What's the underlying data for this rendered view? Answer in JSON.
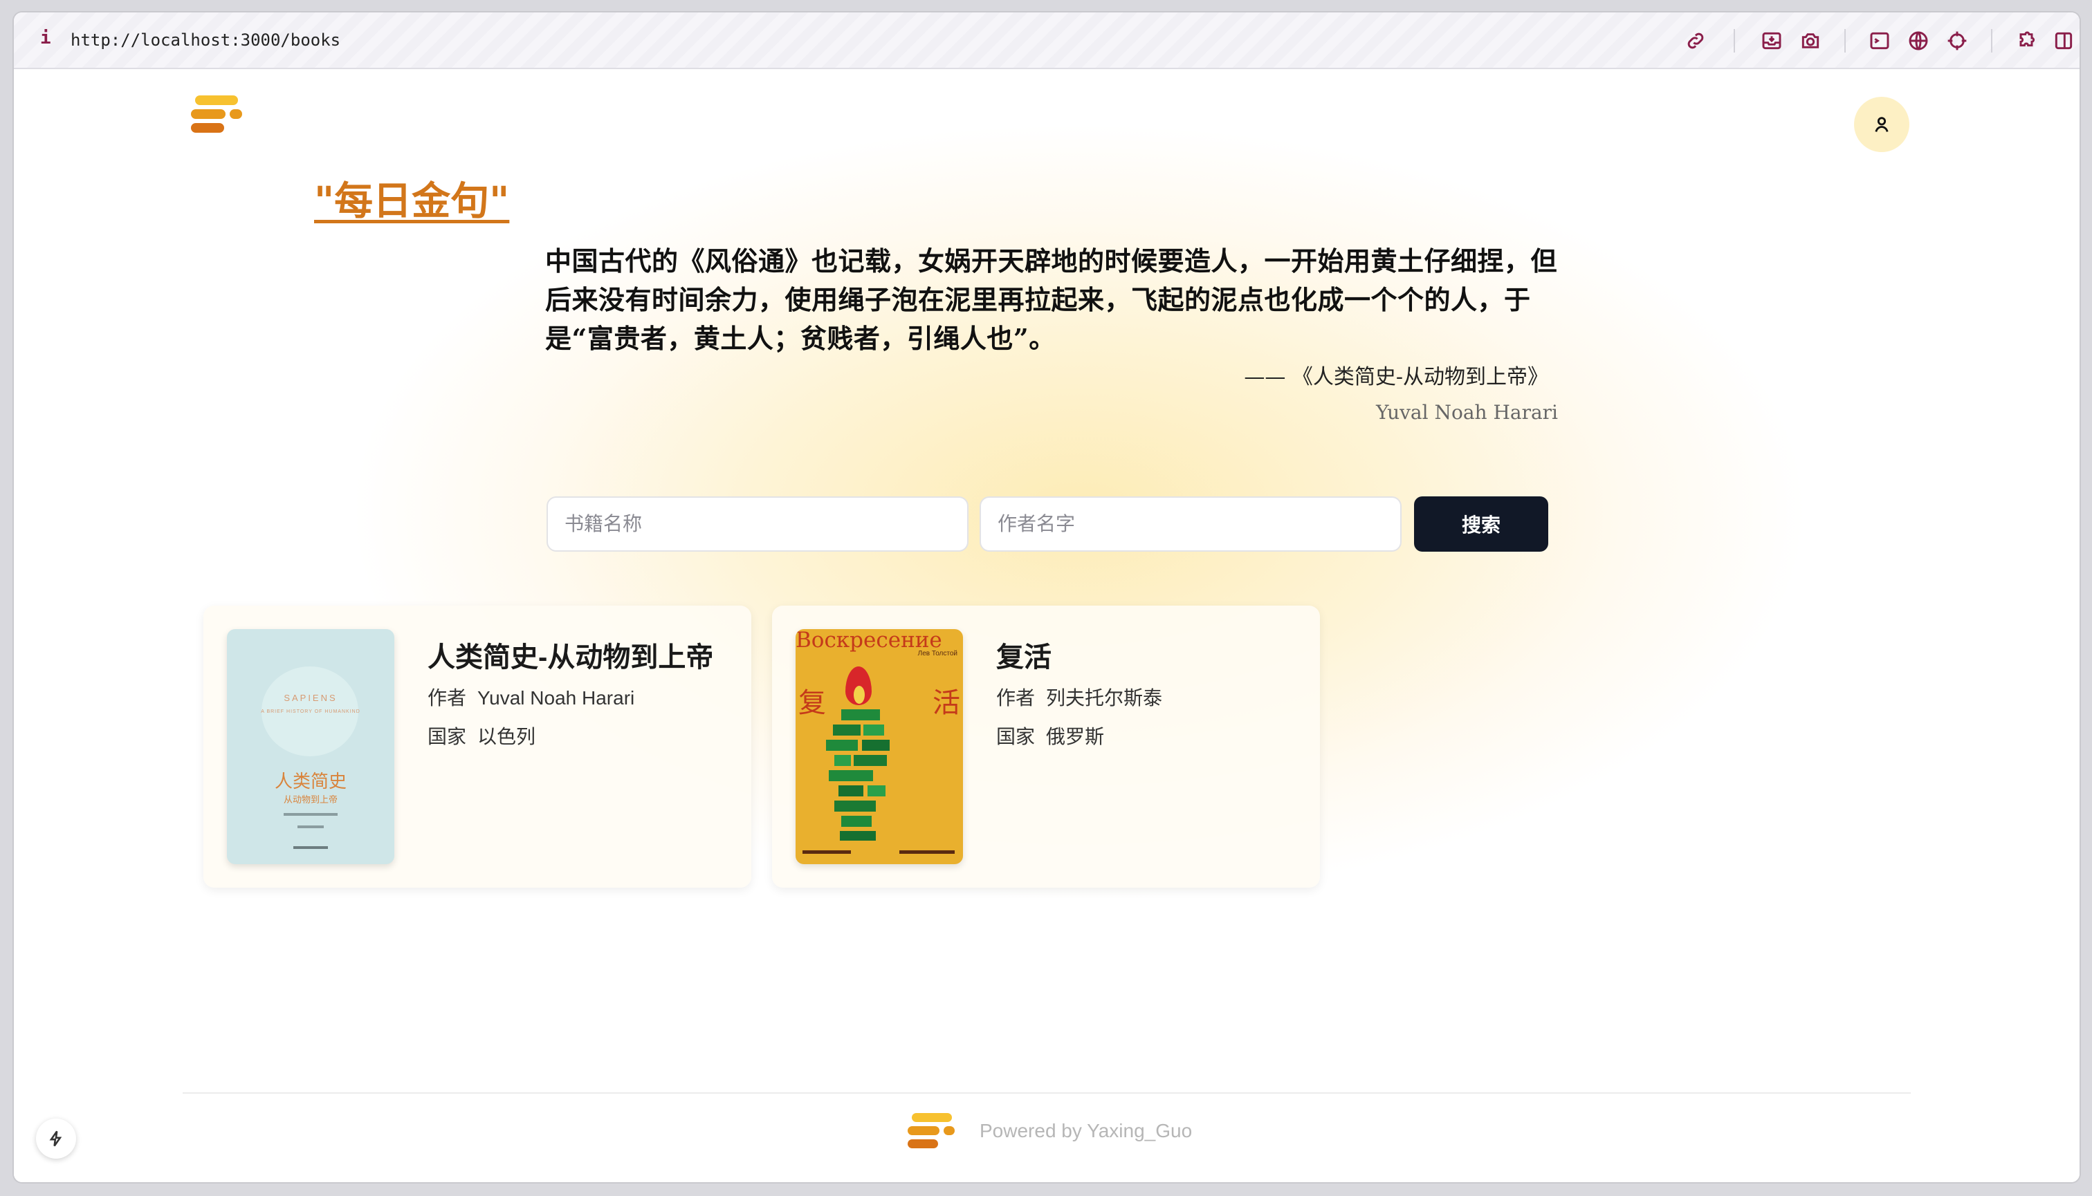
{
  "browser": {
    "info_icon": "info-icon",
    "url": "http://localhost:3000/books",
    "tools": [
      "link-icon",
      "inbox-download-icon",
      "camera-icon",
      "terminal-icon",
      "globe-icon",
      "crosshair-icon",
      "puzzle-icon",
      "split-view-icon"
    ]
  },
  "header": {
    "logo": "stacked-bars-logo",
    "avatar_icon": "user-icon",
    "brand_colors": [
      "#f7c12f",
      "#e8991c",
      "#d97316"
    ]
  },
  "quote": {
    "title": "\"每日金句\"",
    "text": "中国古代的《风俗通》也记载，女娲开天辟地的时候要造人，一开始用黄土仔细捏，但后来没有时间余力，使用绳子泡在泥里再拉起来，飞起的泥点也化成一个个的人，于是“富贵者，黄土人；贫贱者，引绳人也”。",
    "source": "—— 《人类简史-从动物到上帝》",
    "author": "Yuval Noah Harari"
  },
  "search": {
    "book_placeholder": "书籍名称",
    "author_placeholder": "作者名字",
    "button_label": "搜索"
  },
  "books": [
    {
      "title": "人类简史-从动物到上帝",
      "author_label": "作者",
      "author": "Yuval Noah Harari",
      "country_label": "国家",
      "country": "以色列",
      "cover": {
        "top_text": "SAPIENS",
        "sub_text": "A BRIEF HISTORY OF HUMANKIND",
        "cn_title": "人类简史",
        "cn_sub": "从动物到上帝"
      }
    },
    {
      "title": "复活",
      "author_label": "作者",
      "author": "列夫托尔斯泰",
      "country_label": "国家",
      "country": "俄罗斯",
      "cover": {
        "ru_title": "Воскресение",
        "ru_author": "Лев Толстой",
        "cn_left": "复",
        "cn_right": "活"
      }
    }
  ],
  "footer": {
    "powered": "Powered by Yaxing_Guo",
    "bolt_icon": "bolt-icon"
  }
}
